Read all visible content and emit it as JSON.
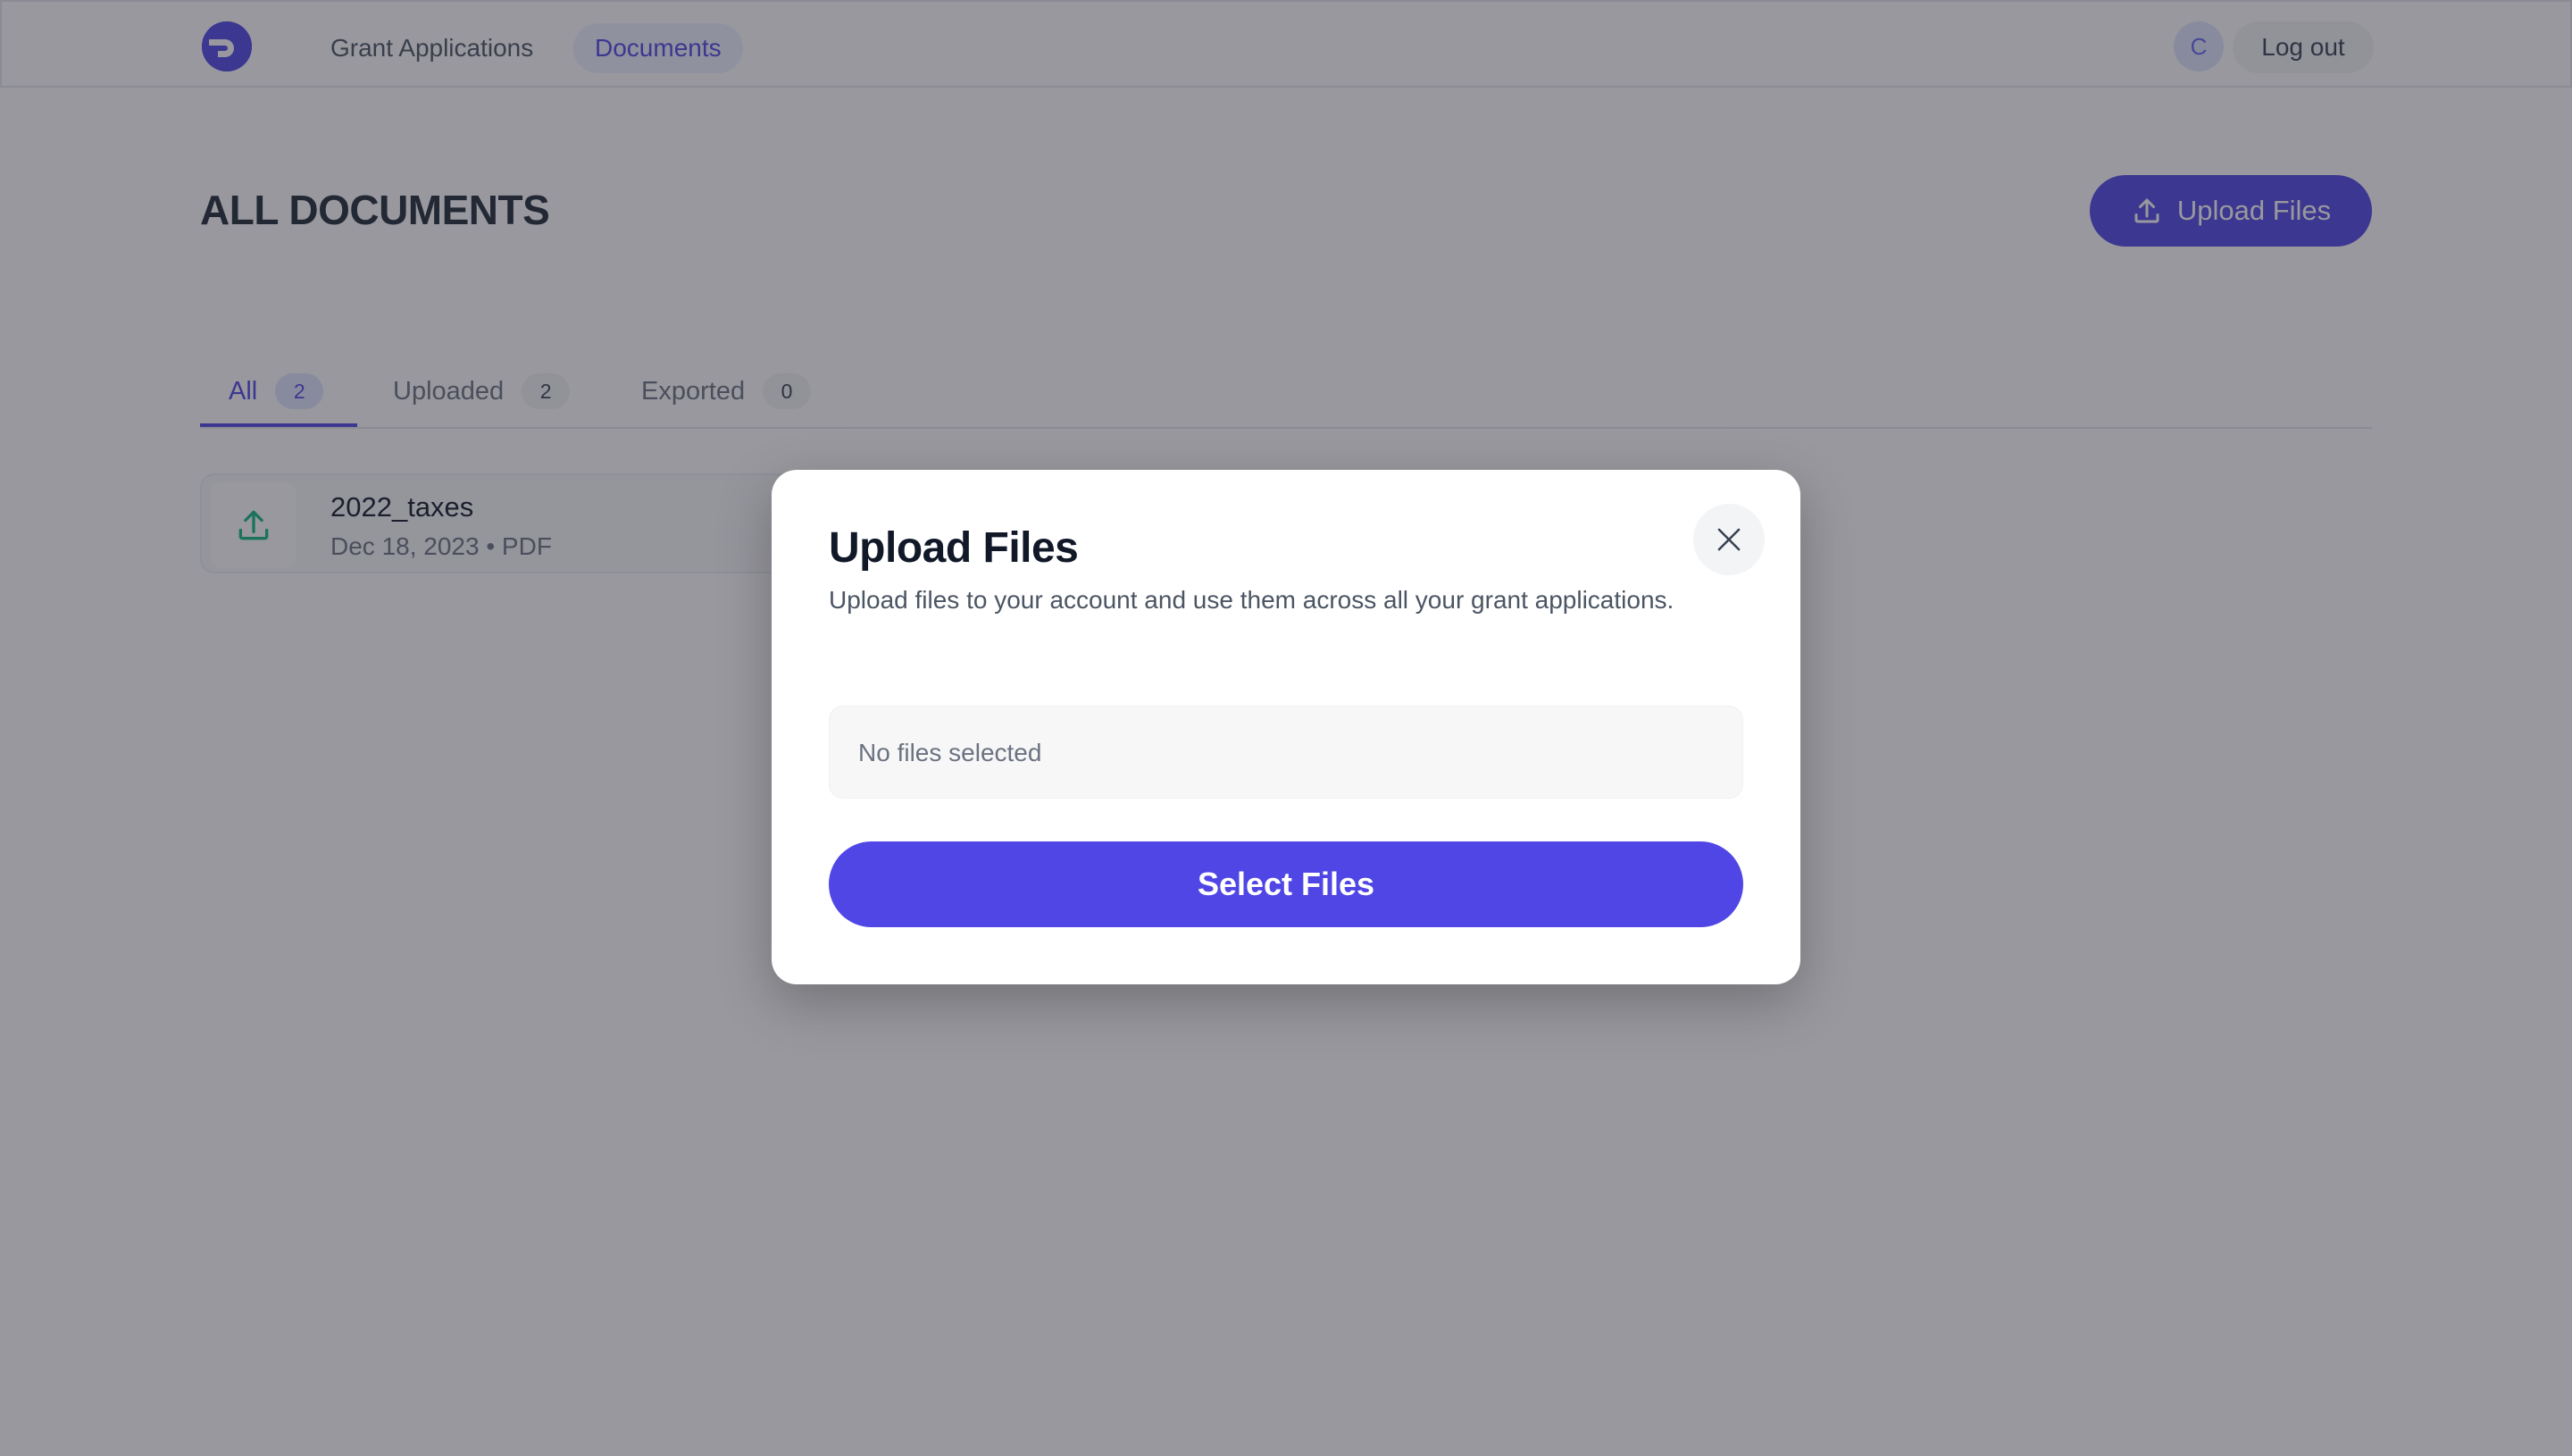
{
  "nav": {
    "links": [
      {
        "label": "Grant Applications"
      },
      {
        "label": "Documents"
      }
    ],
    "avatar_initial": "C",
    "logout_label": "Log out"
  },
  "header": {
    "title": "ALL DOCUMENTS",
    "upload_button_label": "Upload Files",
    "upload_icon": "upload-icon"
  },
  "tabs": [
    {
      "label": "All",
      "count": "2"
    },
    {
      "label": "Uploaded",
      "count": "2"
    },
    {
      "label": "Exported",
      "count": "0"
    }
  ],
  "documents": [
    {
      "name": "2022_taxes",
      "meta": "Dec 18, 2023 • PDF",
      "icon": "upload-icon"
    }
  ],
  "modal": {
    "title": "Upload Files",
    "description": "Upload files to your account and use them across all your grant applications.",
    "file_status": "No files selected",
    "select_button_label": "Select Files",
    "close_icon": "close-icon"
  },
  "colors": {
    "accent": "#4f46e5",
    "overlay": "rgba(40,40,52,0.48)",
    "doc_icon": "#10b981"
  }
}
